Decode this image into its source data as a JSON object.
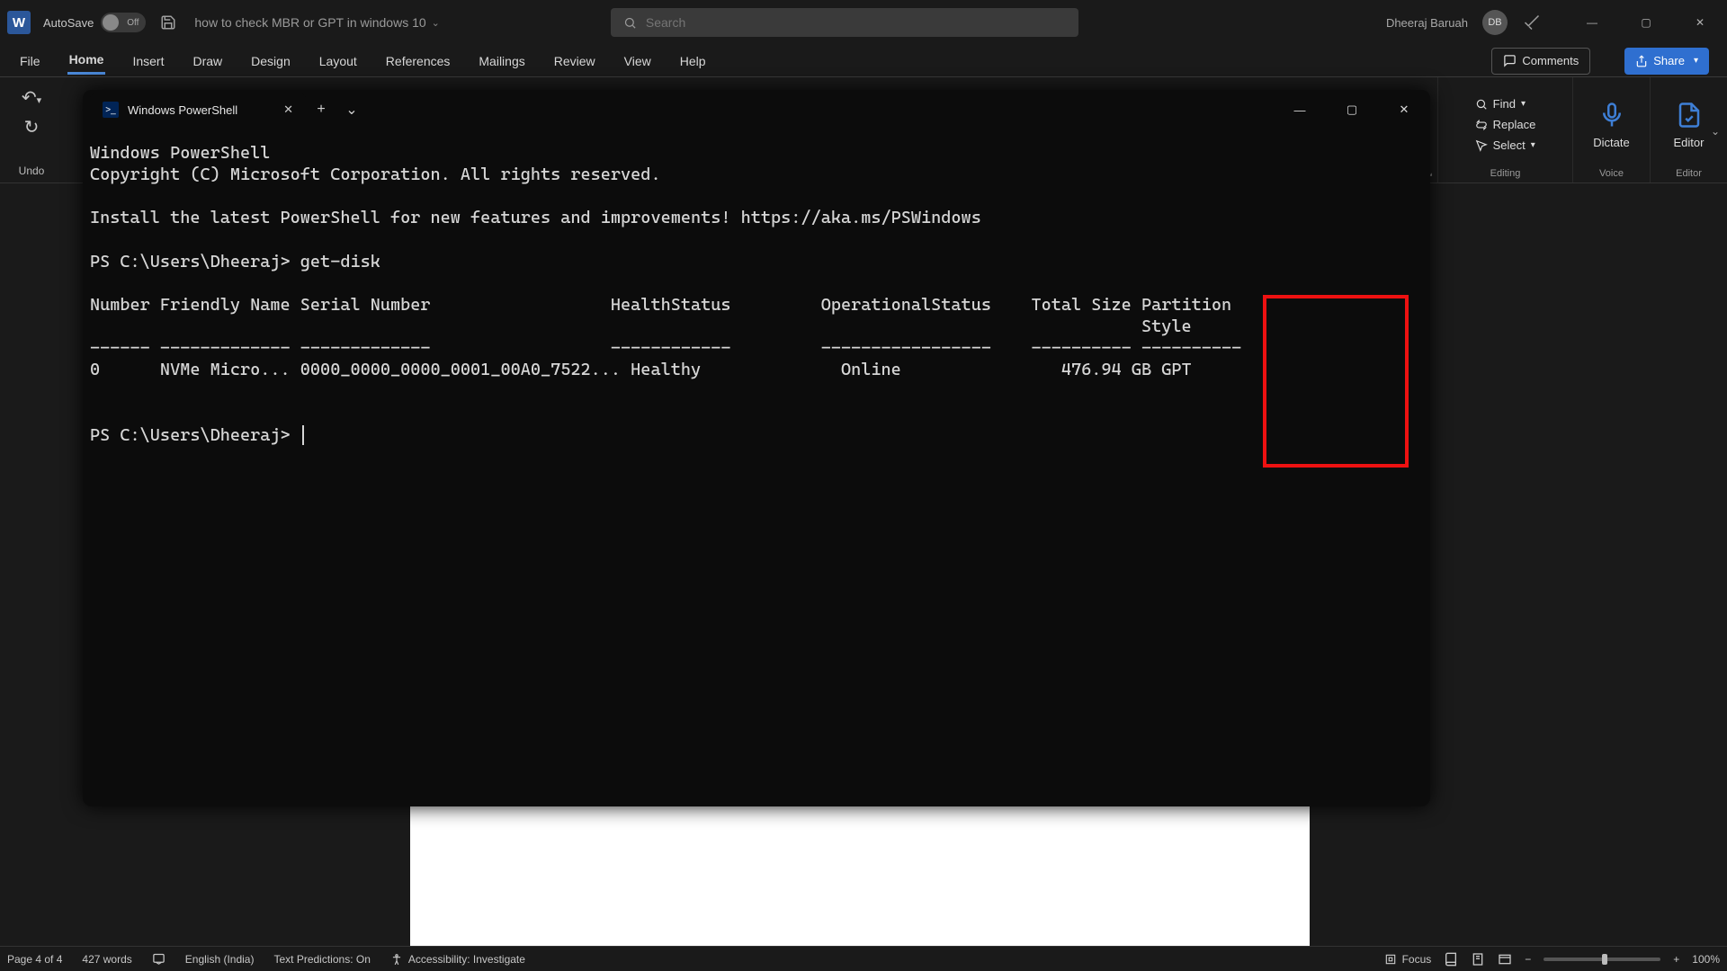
{
  "titlebar": {
    "autosave_label": "AutoSave",
    "autosave_state": "Off",
    "doc_title": "how to check MBR or GPT in windows 10",
    "search_placeholder": "Search",
    "user_name": "Dheeraj Baruah",
    "user_initials": "DB"
  },
  "ribbon_tabs": [
    "File",
    "Home",
    "Insert",
    "Draw",
    "Design",
    "Layout",
    "References",
    "Mailings",
    "Review",
    "View",
    "Help"
  ],
  "ribbon_active_tab": "Home",
  "ribbon_right": {
    "comments": "Comments",
    "share": "Share"
  },
  "undo_label": "Undo",
  "editing_group": {
    "find": "Find",
    "replace": "Replace",
    "select": "Select",
    "label": "Editing"
  },
  "voice_group": {
    "dictate": "Dictate",
    "label": "Voice"
  },
  "editor_group": {
    "editor": "Editor",
    "label": "Editor"
  },
  "terminal": {
    "tab_title": "Windows PowerShell",
    "body_lines": [
      "Windows PowerShell",
      "Copyright (C) Microsoft Corporation. All rights reserved.",
      "",
      "Install the latest PowerShell for new features and improvements! https://aka.ms/PSWindows",
      "",
      "PS C:\\Users\\Dheeraj> get-disk",
      "",
      "Number Friendly Name Serial Number                  HealthStatus         OperationalStatus    Total Size Partition",
      "                                                                                                         Style",
      "------ ------------- -------------                  ------------         -----------------    ---------- ----------",
      "0      NVMe Micro... 0000_0000_0000_0001_00A0_7522... Healthy              Online                476.94 GB GPT",
      "",
      "",
      "PS C:\\Users\\Dheeraj> "
    ],
    "prompt_path": "PS C:\\Users\\Dheeraj>",
    "command": "get-disk",
    "table": {
      "headers": [
        "Number",
        "Friendly Name",
        "Serial Number",
        "HealthStatus",
        "OperationalStatus",
        "Total Size",
        "Partition Style"
      ],
      "rows": [
        {
          "Number": "0",
          "Friendly Name": "NVMe Micro...",
          "Serial Number": "0000_0000_0000_0001_00A0_7522...",
          "HealthStatus": "Healthy",
          "OperationalStatus": "Online",
          "Total Size": "476.94 GB",
          "Partition Style": "GPT"
        }
      ]
    },
    "highlight_column": "Partition Style"
  },
  "statusbar": {
    "page": "Page 4 of 4",
    "words": "427 words",
    "language": "English (India)",
    "predictions": "Text Predictions: On",
    "accessibility": "Accessibility: Investigate",
    "focus": "Focus",
    "zoom": "100%"
  }
}
